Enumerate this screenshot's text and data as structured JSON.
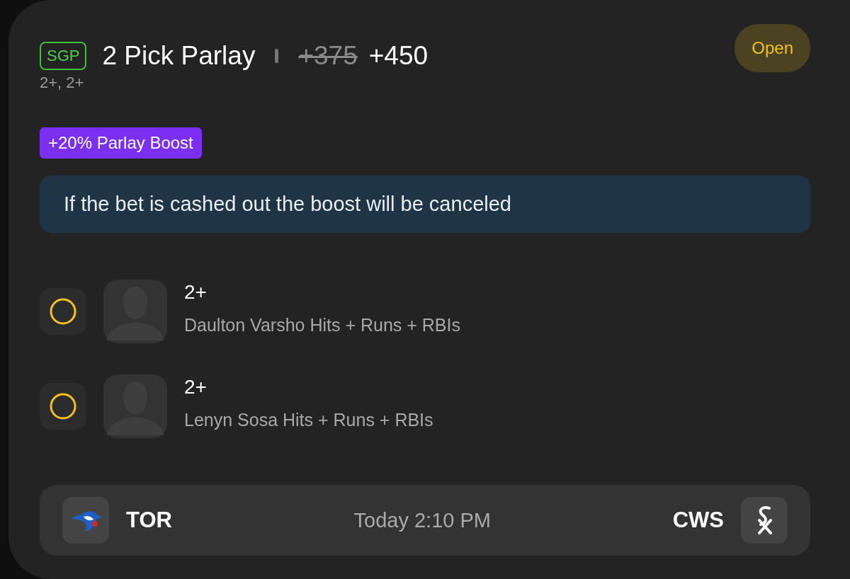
{
  "bet": {
    "tag": "SGP",
    "title": "2 Pick Parlay",
    "original_odds": "+375",
    "odds": "+450",
    "subtitle": "2+, 2+",
    "status": "Open"
  },
  "boost": {
    "label": "+20% Parlay Boost"
  },
  "notice": "If the bet is cashed out the boost will be canceled",
  "legs": [
    {
      "line": "2+",
      "description": "Daulton Varsho Hits + Runs + RBIs"
    },
    {
      "line": "2+",
      "description": "Lenyn Sosa Hits + Runs + RBIs"
    }
  ],
  "game": {
    "away": "TOR",
    "time": "Today 2:10 PM",
    "home": "CWS"
  }
}
